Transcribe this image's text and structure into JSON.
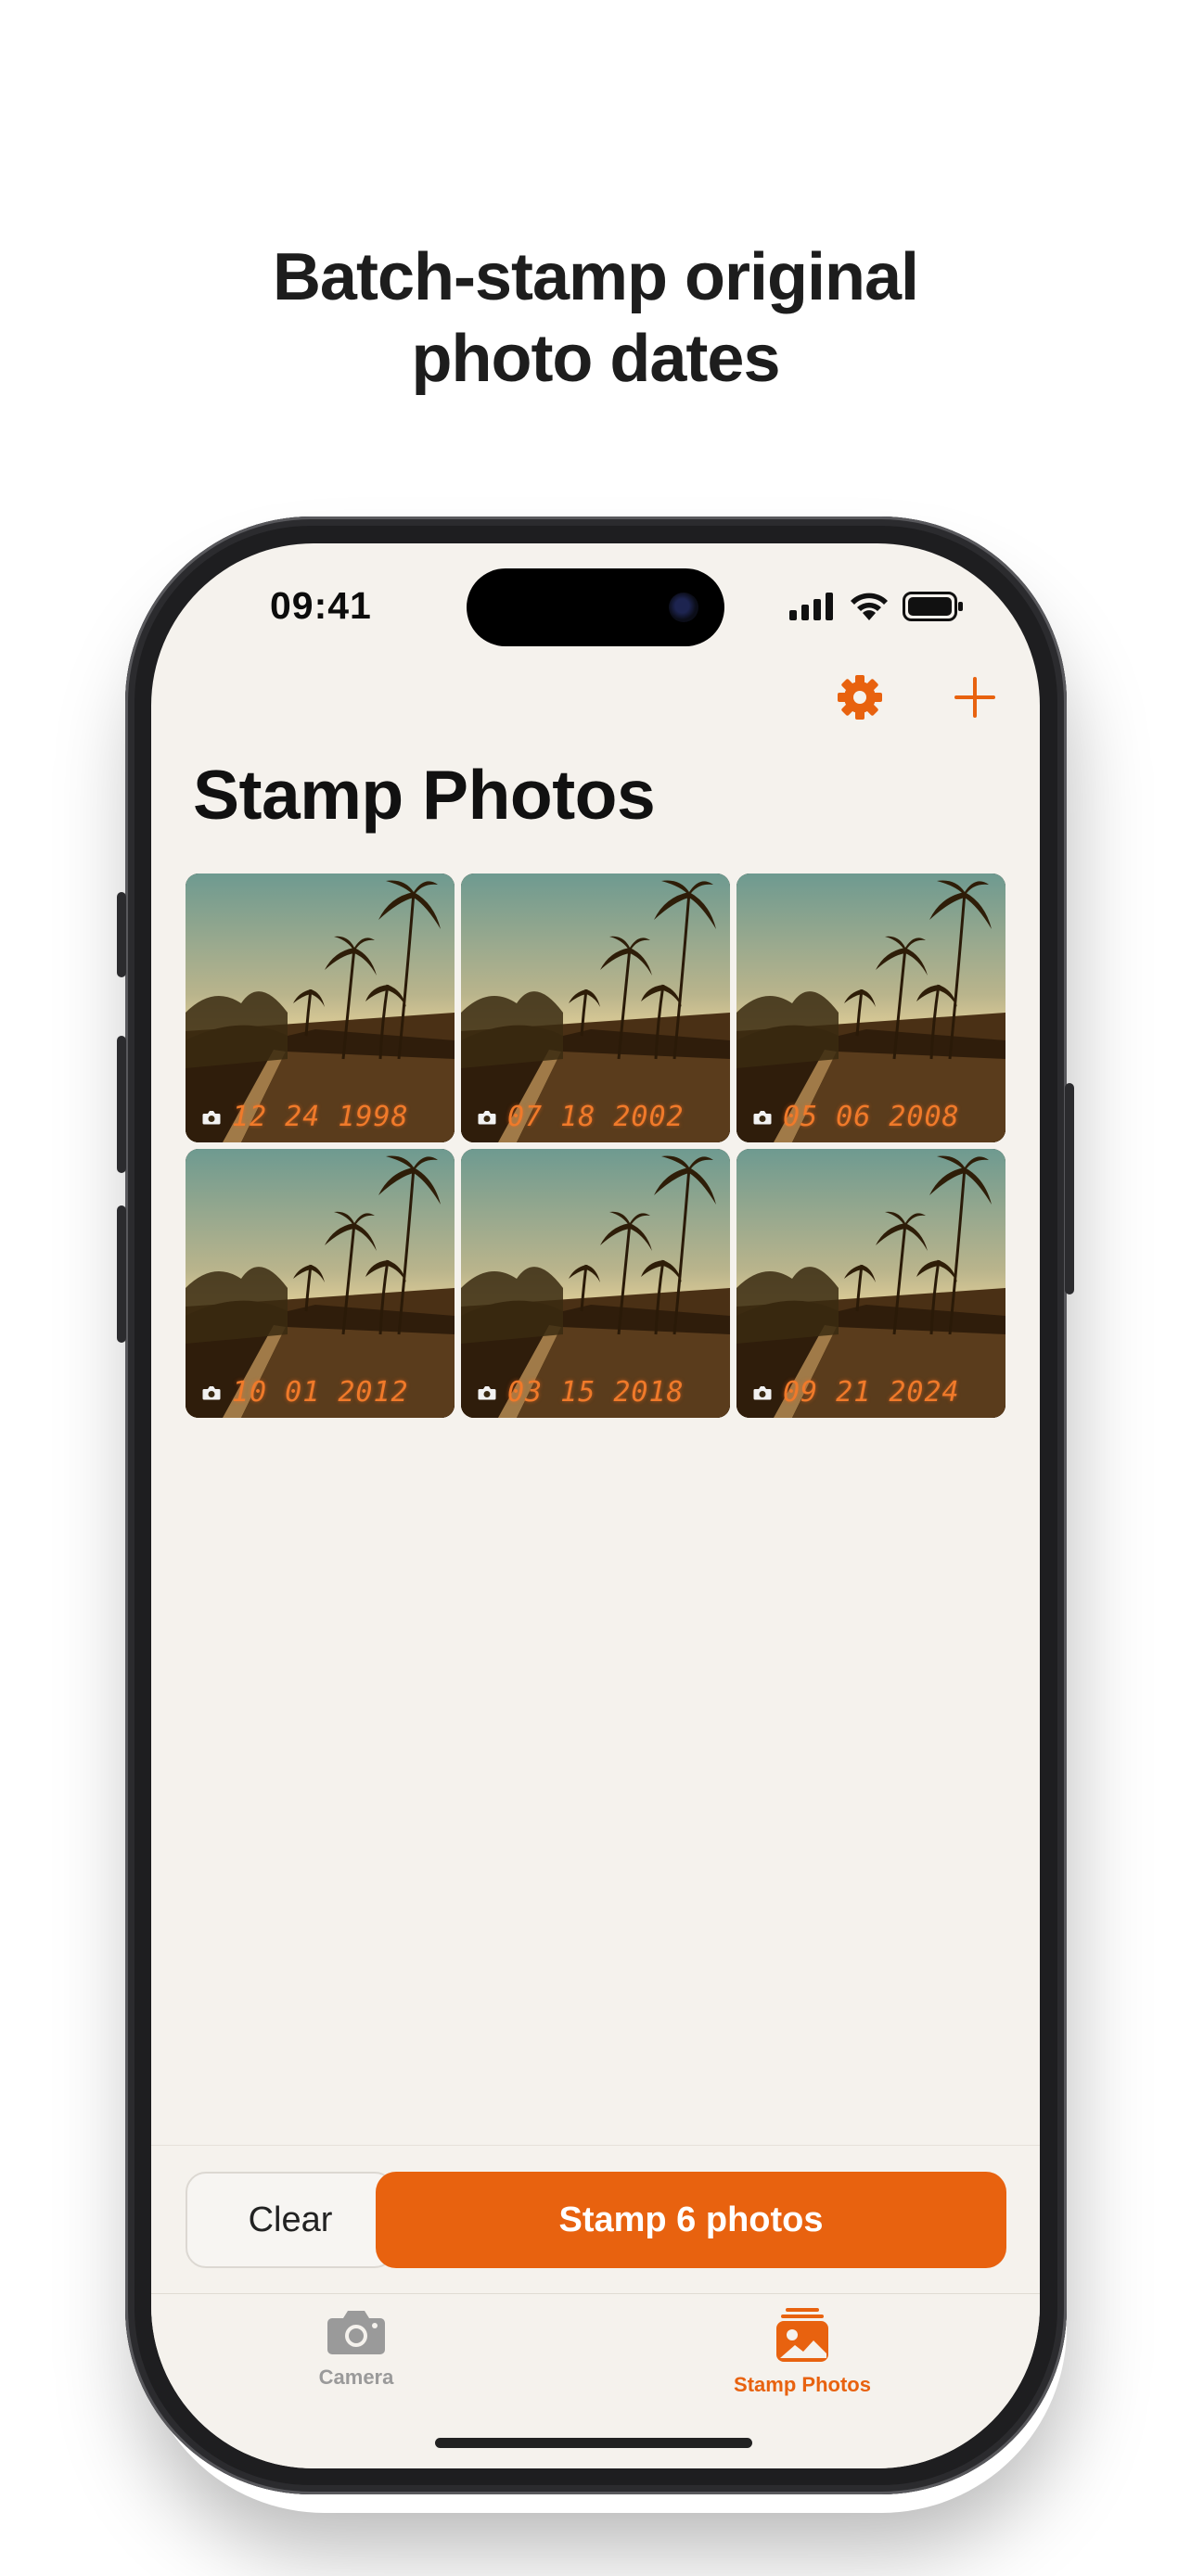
{
  "headline": {
    "line1": "Batch-stamp original",
    "line2": "photo dates"
  },
  "status_bar": {
    "time": "09:41"
  },
  "nav": {
    "title": "Stamp Photos"
  },
  "photos": [
    {
      "date": "12 24 1998"
    },
    {
      "date": "07 18 2002"
    },
    {
      "date": "05 06 2008"
    },
    {
      "date": "10 01 2012"
    },
    {
      "date": "03 15 2018"
    },
    {
      "date": "09 21 2024"
    }
  ],
  "actions": {
    "clear_label": "Clear",
    "stamp_label": "Stamp 6 photos"
  },
  "tabs": [
    {
      "label": "Camera",
      "icon": "camera-icon",
      "selected": false
    },
    {
      "label": "Stamp Photos",
      "icon": "photo-stack-icon",
      "selected": true
    }
  ],
  "colors": {
    "accent": "#e8620f",
    "background": "#f5f2ed",
    "tab_inactive": "#9a9a9a"
  }
}
